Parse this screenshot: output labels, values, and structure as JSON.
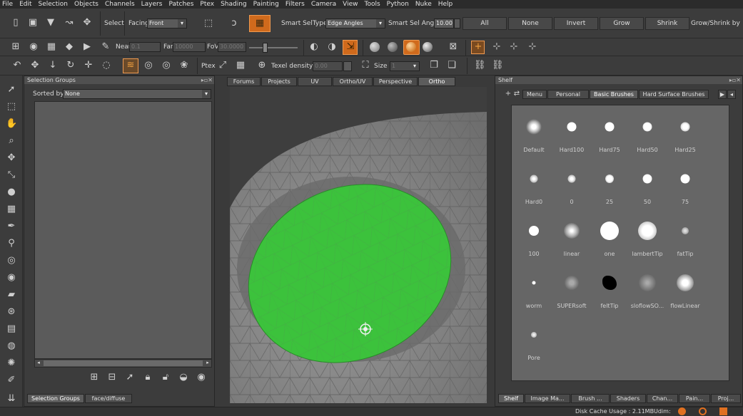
{
  "menu": [
    "File",
    "Edit",
    "Selection",
    "Objects",
    "Channels",
    "Layers",
    "Patches",
    "Ptex",
    "Shading",
    "Painting",
    "Filters",
    "Camera",
    "View",
    "Tools",
    "Python",
    "Nuke",
    "Help"
  ],
  "toolbar1": {
    "select_label": "Select",
    "facing_label": "Facing",
    "facing_value": "Front",
    "smart_sel_type_label": "Smart SelType:",
    "smart_sel_type_value": "Edge Angles",
    "smart_sel_angle_label": "Smart Sel Angle",
    "smart_sel_angle_value": "10.00",
    "buttons": [
      "All",
      "None",
      "Invert",
      "Grow",
      "Shrink"
    ],
    "grow_shrink_label": "Grow/Shrink by"
  },
  "toolbar2": {
    "near_label": "Near",
    "near_value": "0.1",
    "far_label": "Far",
    "far_value": "10000",
    "fov_label": "FoV",
    "fov_value": "30.0000"
  },
  "toolbar3": {
    "ptex_label": "Ptex",
    "texel_density_label": "Texel density :",
    "texel_density_value": "0.00",
    "size_label": "Size :",
    "size_value": "1"
  },
  "selection_groups": {
    "title": "Selection Groups",
    "sorted_by_label": "Sorted by",
    "sorted_by_value": "None",
    "bottom_tabs": [
      "Selection Groups",
      "face/diffuse"
    ]
  },
  "viewport": {
    "tabs": [
      "Forums",
      "Projects",
      "UV",
      "Ortho/UV",
      "Perspective",
      "Ortho"
    ],
    "active_tab": "Ortho",
    "selection_color": "#3cc23c",
    "mesh_color": "#8c8c8c"
  },
  "shelf": {
    "title": "Shelf",
    "tabs": [
      "Menu",
      "Personal",
      "Basic Brushes",
      "Hard Surface Brushes"
    ],
    "active_tab": "Basic Brushes",
    "brushes": [
      "Default",
      "Hard100",
      "Hard75",
      "Hard50",
      "Hard25",
      "Hard0",
      "0",
      "25",
      "50",
      "75",
      "100",
      "linear",
      "one",
      "lambertTip",
      "fatTip",
      "worm",
      "SUPERsoft",
      "feltTip",
      "sloflowSO...",
      "flowLinear",
      "Pore"
    ],
    "bottom_tabs": [
      "Shelf",
      "Image Ma...",
      "Brush ...",
      "Shaders",
      "Chan...",
      "Pain...",
      "Proj..."
    ]
  },
  "status": {
    "disk_cache": "Disk Cache Usage : 2.11MB",
    "udim_label": "Udim:"
  }
}
